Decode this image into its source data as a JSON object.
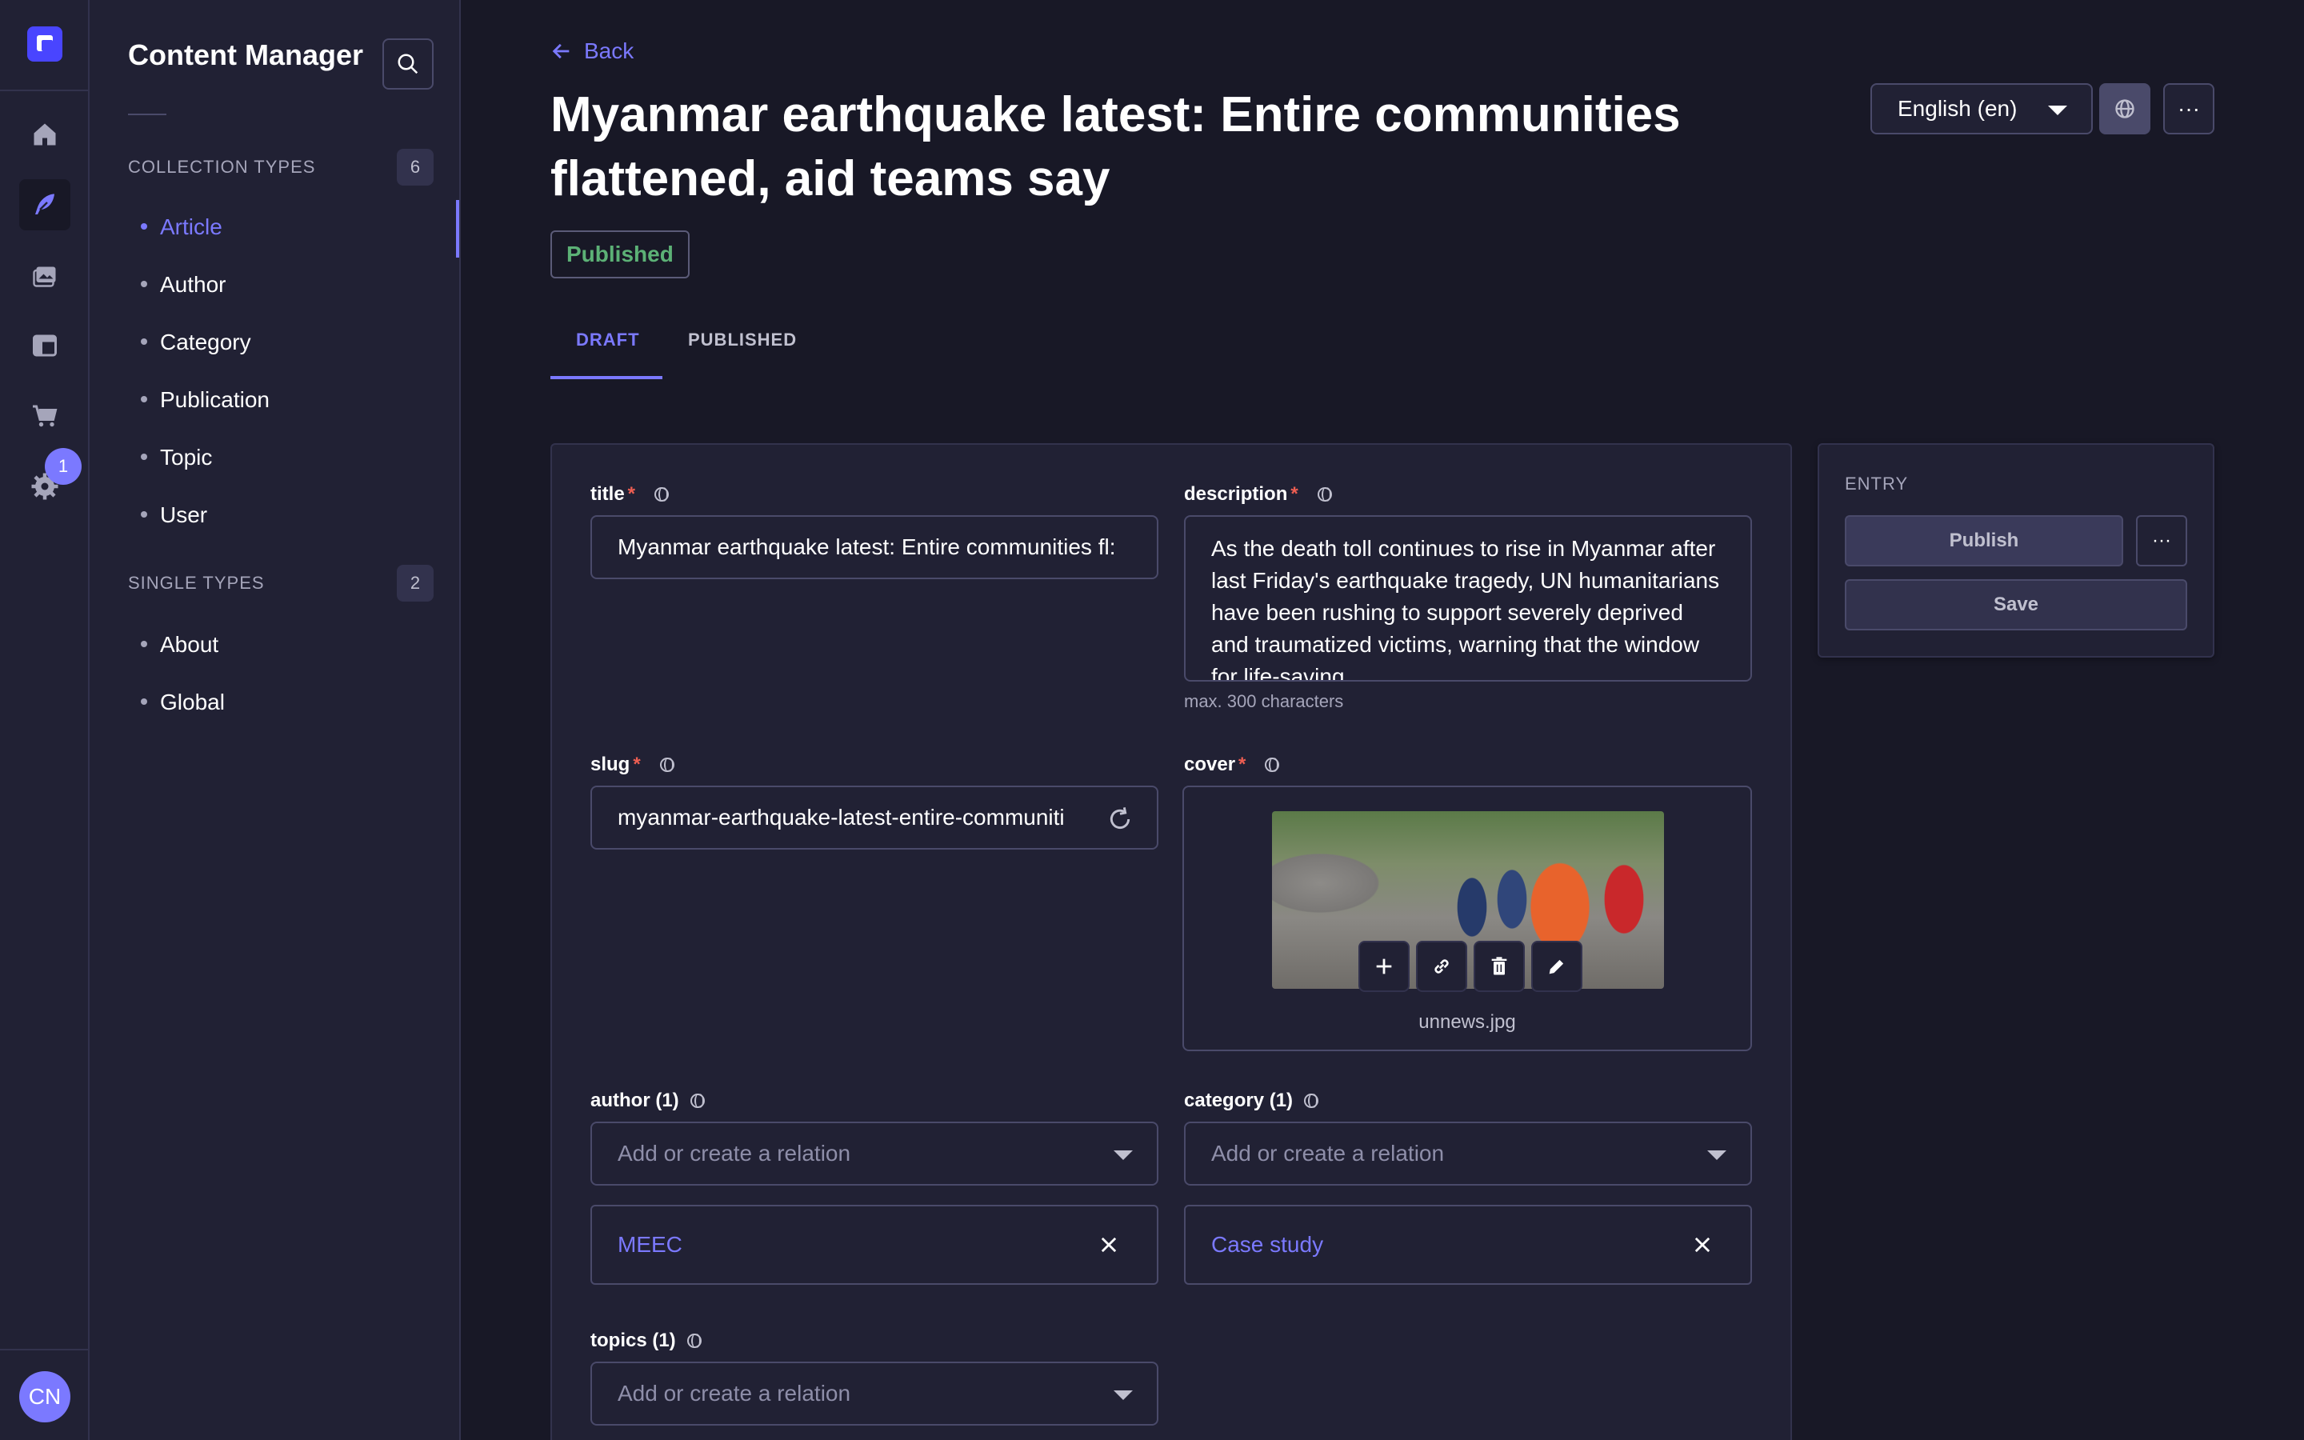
{
  "rail": {
    "notification_count": "1",
    "avatar_initials": "CN",
    "items": [
      "home-icon",
      "content-manager-icon",
      "media-library-icon",
      "content-type-builder-icon",
      "marketplace-icon",
      "settings-icon"
    ]
  },
  "subnav": {
    "title": "Content Manager",
    "collection_types": {
      "heading": "COLLECTION TYPES",
      "count": "6",
      "items": [
        "Article",
        "Author",
        "Category",
        "Publication",
        "Topic",
        "User"
      ],
      "active": "Article"
    },
    "single_types": {
      "heading": "SINGLE TYPES",
      "count": "2",
      "items": [
        "About",
        "Global"
      ]
    }
  },
  "header": {
    "back_label": "Back",
    "title": "Myanmar earthquake latest: Entire communities flattened, aid teams say",
    "status": "Published",
    "locale": "English (en)",
    "more_label": "···"
  },
  "tabs": {
    "draft": "DRAFT",
    "published": "PUBLISHED",
    "active": "DRAFT"
  },
  "form": {
    "title": {
      "label": "title",
      "required": "*",
      "value": "Myanmar earthquake latest: Entire communities fl:"
    },
    "description": {
      "label": "description",
      "required": "*",
      "value": "As the death toll continues to rise in Myanmar after last Friday's earthquake tragedy, UN humanitarians have been rushing to support severely deprived and traumatized victims, warning that the window for life-saving",
      "hint": "max. 300 characters"
    },
    "slug": {
      "label": "slug",
      "required": "*",
      "value": "myanmar-earthquake-latest-entire-communiti"
    },
    "cover": {
      "label": "cover",
      "required": "*",
      "filename": "unnews.jpg",
      "actions": [
        "plus-icon",
        "link-icon",
        "trash-icon",
        "pencil-icon"
      ]
    },
    "author": {
      "label": "author (1)",
      "placeholder": "Add or create a relation",
      "selected": "MEEC"
    },
    "category": {
      "label": "category (1)",
      "placeholder": "Add or create a relation",
      "selected": "Case study"
    },
    "topics": {
      "label": "topics (1)",
      "placeholder": "Add or create a relation"
    }
  },
  "entry_panel": {
    "heading": "ENTRY",
    "publish_label": "Publish",
    "more_label": "···",
    "save_label": "Save"
  },
  "colors": {
    "background": "#181826",
    "surface": "#212134",
    "accent": "#7b79ff",
    "published_green": "#5cb176",
    "required_red": "#ee5e52"
  }
}
